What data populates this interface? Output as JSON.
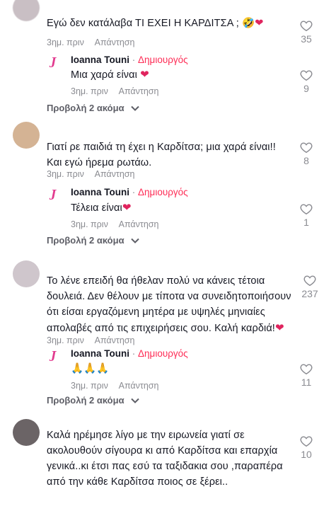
{
  "comments": [
    {
      "text": "Εγώ δεν κατάλαβα ΤΙ ΕΧΕΙ Η ΚΑΡΔΙΤΣΑ ;",
      "emoji": "🤣❤",
      "time": "3ημ. πριν",
      "reply_label": "Απάντηση",
      "likes": "35",
      "reply": {
        "author": "Ioanna Touni",
        "separator": "·",
        "badge": "Δημιουργός",
        "text": "Μια χαρά είναι",
        "emoji": "❤",
        "time": "3ημ. πριν",
        "reply_label": "Απάντηση",
        "likes": "9"
      },
      "more_label": "Προβολή 2 ακόμα"
    },
    {
      "text_lines": [
        "Γιατί ρε παιδιά τη έχει η Καρδίτσα; μια χαρά είναι!!",
        "Και εγώ ήρεμα ρωτάω."
      ],
      "time": "3ημ. πριν",
      "reply_label": "Απάντηση",
      "likes": "8",
      "reply": {
        "author": "Ioanna Touni",
        "separator": "·",
        "badge": "Δημιουργός",
        "text": "Τέλεια είναι",
        "emoji": "❤",
        "time": "3ημ. πριν",
        "reply_label": "Απάντηση",
        "likes": "1"
      },
      "more_label": "Προβολή 2 ακόμα"
    },
    {
      "text_lines": [
        "Το λένε επειδή θα ήθελαν πολύ να κάνεις τέτοια",
        "δουλειά. Δεν θέλουν με τίποτα να συνειδητοποιήσουν",
        "ότι είσαι εργαζόμενη μητέρα με υψηλές μηνιαίες",
        "απολαβές από τις επιχειρήσεις σου. Καλή καρδιά!"
      ],
      "emoji": "❤",
      "time": "3ημ. πριν",
      "reply_label": "Απάντηση",
      "likes": "237",
      "reply": {
        "author": "Ioanna Touni",
        "separator": "·",
        "badge": "Δημιουργός",
        "text": "🙏🙏🙏",
        "time": "3ημ. πριν",
        "reply_label": "Απάντηση",
        "likes": "11"
      },
      "more_label": "Προβολή 2 ακόμα"
    },
    {
      "text_lines": [
        "Καλά ηρέμησε λίγο με την ειρωνεία γιατί σε",
        "ακολουθούν σίγουρα κι από Καρδίτσα και επαρχία",
        "γενικά..κι έτσι πας εσύ τα ταξιδακια σου ,παραπέρα",
        "από την κάθε Καρδίτσα ποιος σε ξέρει.."
      ],
      "likes": "10"
    }
  ],
  "creator_logo": "J",
  "colors": {
    "accent": "#fe2c55",
    "heart": "#e0245e",
    "muted": "#8a8b91",
    "text": "#161823"
  },
  "icons": {
    "like": "heart-outline-icon",
    "expand": "chevron-down-icon"
  }
}
